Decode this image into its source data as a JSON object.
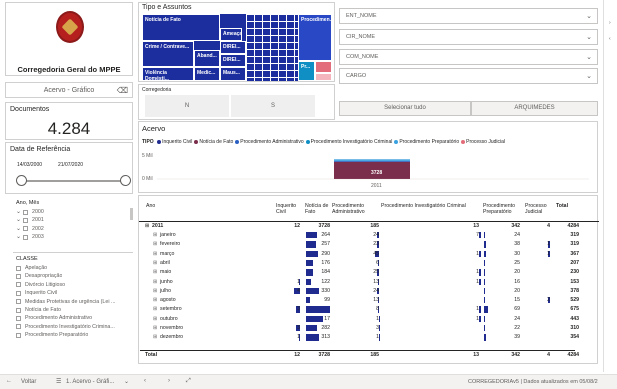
{
  "brand": {
    "title": "Corregedoria Geral do MPPE"
  },
  "view_toggle": {
    "label": "Acervo - Gráfico"
  },
  "documents": {
    "label": "Documentos",
    "value": "4.284"
  },
  "date_ref": {
    "label": "Data de Referência",
    "start": "14/03/2000",
    "end": "21/07/2020"
  },
  "ano_mes": {
    "label": "Ano, Mês",
    "items": [
      "2000",
      "2001",
      "2002",
      "2003"
    ]
  },
  "classe": {
    "label": "CLASSE",
    "items": [
      "Apelação",
      "Desapropriação",
      "Divórcio Litigioso",
      "Inquerito Civil",
      "Medidas Protetivas de urgência (Lei ...",
      "Notícia de Fato",
      "Procedimento Administrativo",
      "Procedimento Investigatório Crimina...",
      "Procedimento Preparatório"
    ]
  },
  "tipo_assuntos": {
    "title": "Tipo e Assuntos",
    "tiles": [
      "Notícia de Fato",
      "Ameaça",
      "Procedimen...",
      "Crime / Contrave...",
      "Aband...",
      "DIREI...",
      "DIREI...",
      "Violência Domésti...",
      "Medic...",
      "Maus...",
      "Pr..."
    ]
  },
  "corregedoria": {
    "label": "Corregedoria",
    "options": [
      "N",
      "S"
    ]
  },
  "filters": {
    "ent_nome": "ENT_NOME",
    "cir_nome": "CIR_NOME",
    "com_nome": "COM_NOME",
    "cargo": "CARGO",
    "select_all": "Selecionar tudo",
    "arquimedes": "ARQUIMEDES"
  },
  "acervo": {
    "title": "Acervo",
    "legend_title": "TIPO",
    "legend": [
      {
        "name": "Inquerito Civil",
        "color": "#1f2b8f"
      },
      {
        "name": "Notícia de Fato",
        "color": "#7a2e4b"
      },
      {
        "name": "Procedimento Administrativo",
        "color": "#2b5fc2"
      },
      {
        "name": "Procedimento Investigatório Criminal",
        "color": "#0f8fc4"
      },
      {
        "name": "Procedimento Preparatório",
        "color": "#3aa1e0"
      },
      {
        "name": "Processo Judicial",
        "color": "#e36d7a"
      }
    ],
    "y_ticks": [
      "5 Mil",
      "0 Mil"
    ],
    "bar_label": "3728",
    "x_label": "2011"
  },
  "chart_data": {
    "type": "bar",
    "categories": [
      "2011"
    ],
    "series": [
      {
        "name": "Inquerito Civil",
        "values": [
          12
        ]
      },
      {
        "name": "Notícia de Fato",
        "values": [
          3728
        ]
      },
      {
        "name": "Procedimento Administrativo",
        "values": [
          185
        ]
      },
      {
        "name": "Procedimento Investigatório Criminal",
        "values": [
          13
        ]
      },
      {
        "name": "Procedimento Preparatório",
        "values": [
          342
        ]
      },
      {
        "name": "Processo Judicial",
        "values": [
          4
        ]
      }
    ],
    "ylim": [
      0,
      5000
    ],
    "stacked": true
  },
  "table": {
    "headers": [
      "Ano",
      "Inquerito Civil",
      "Notícia de Fato",
      "Procedimento Administrativo",
      "Procedimento Investigatório Criminal",
      "Procedimento Preparatório",
      "Processo Judicial",
      "Total"
    ],
    "year_row": {
      "label": "2011",
      "vals": [
        "12",
        "3728",
        "185",
        "13",
        "342",
        "4",
        "4284"
      ]
    },
    "rows": [
      {
        "label": "janeiro",
        "vals": [
          "",
          "264",
          "24",
          "7",
          "24",
          "",
          "319"
        ],
        "nf": 264,
        "pa": 24,
        "pic": 7,
        "pp": 24,
        "pj": 0,
        "ic": 0
      },
      {
        "label": "fevereiro",
        "vals": [
          "",
          "257",
          "23",
          "",
          "38",
          "1",
          "319"
        ],
        "nf": 257,
        "pa": 23,
        "pic": 0,
        "pp": 38,
        "pj": 1,
        "ic": 0
      },
      {
        "label": "março",
        "vals": [
          "",
          "290",
          "45",
          "1",
          "30",
          "1",
          "367"
        ],
        "nf": 290,
        "pa": 45,
        "pic": 1,
        "pp": 30,
        "pj": 1,
        "ic": 0
      },
      {
        "label": "abril",
        "vals": [
          "",
          "176",
          "6",
          "",
          "25",
          "",
          "207"
        ],
        "nf": 176,
        "pa": 6,
        "pic": 0,
        "pp": 25,
        "pj": 0,
        "ic": 0
      },
      {
        "label": "maio",
        "vals": [
          "",
          "184",
          "25",
          "1",
          "20",
          "",
          "230"
        ],
        "nf": 184,
        "pa": 25,
        "pic": 1,
        "pp": 20,
        "pj": 0,
        "ic": 0
      },
      {
        "label": "junho",
        "vals": [
          "1",
          "122",
          "13",
          "1",
          "16",
          "",
          "153"
        ],
        "nf": 122,
        "pa": 13,
        "pic": 1,
        "pp": 16,
        "pj": 0,
        "ic": 1
      },
      {
        "label": "julho",
        "vals": [
          "4",
          "330",
          "24",
          "",
          "20",
          "",
          "378"
        ],
        "nf": 330,
        "pa": 24,
        "pic": 0,
        "pp": 20,
        "pj": 0,
        "ic": 4
      },
      {
        "label": "agosto",
        "vals": [
          "",
          "99",
          "13",
          "",
          "15",
          "2",
          "529"
        ],
        "nf": 99,
        "pa": 13,
        "pic": 0,
        "pp": 15,
        "pj": 2,
        "ic": 0
      },
      {
        "label": "setembro",
        "vals": [
          "3",
          "",
          "8",
          "1",
          "69",
          "",
          "675"
        ],
        "nf": 594,
        "pa": 8,
        "pic": 1,
        "pp": 69,
        "pj": 0,
        "ic": 3
      },
      {
        "label": "outubro",
        "vals": [
          "",
          "17",
          "1",
          "1",
          "24",
          "",
          "443"
        ],
        "nf": 417,
        "pa": 1,
        "pic": 1,
        "pp": 24,
        "pj": 0,
        "ic": 0
      },
      {
        "label": "novembro",
        "vals": [
          "3",
          "282",
          "3",
          "",
          "22",
          "",
          "310"
        ],
        "nf": 282,
        "pa": 3,
        "pic": 0,
        "pp": 22,
        "pj": 0,
        "ic": 3
      },
      {
        "label": "dezembro",
        "vals": [
          "1",
          "313",
          "1",
          "",
          "39",
          "",
          "354"
        ],
        "nf": 313,
        "pa": 1,
        "pic": 0,
        "pp": 39,
        "pj": 0,
        "ic": 1
      }
    ],
    "total_row": {
      "label": "Total",
      "vals": [
        "12",
        "3728",
        "185",
        "13",
        "342",
        "4",
        "4284"
      ]
    }
  },
  "footer": {
    "back": "Voltar",
    "page": "1. Acervo - Gráfi...",
    "status": "CORREGEDORIAv5 | Dados atualizados em 05/08/2"
  }
}
